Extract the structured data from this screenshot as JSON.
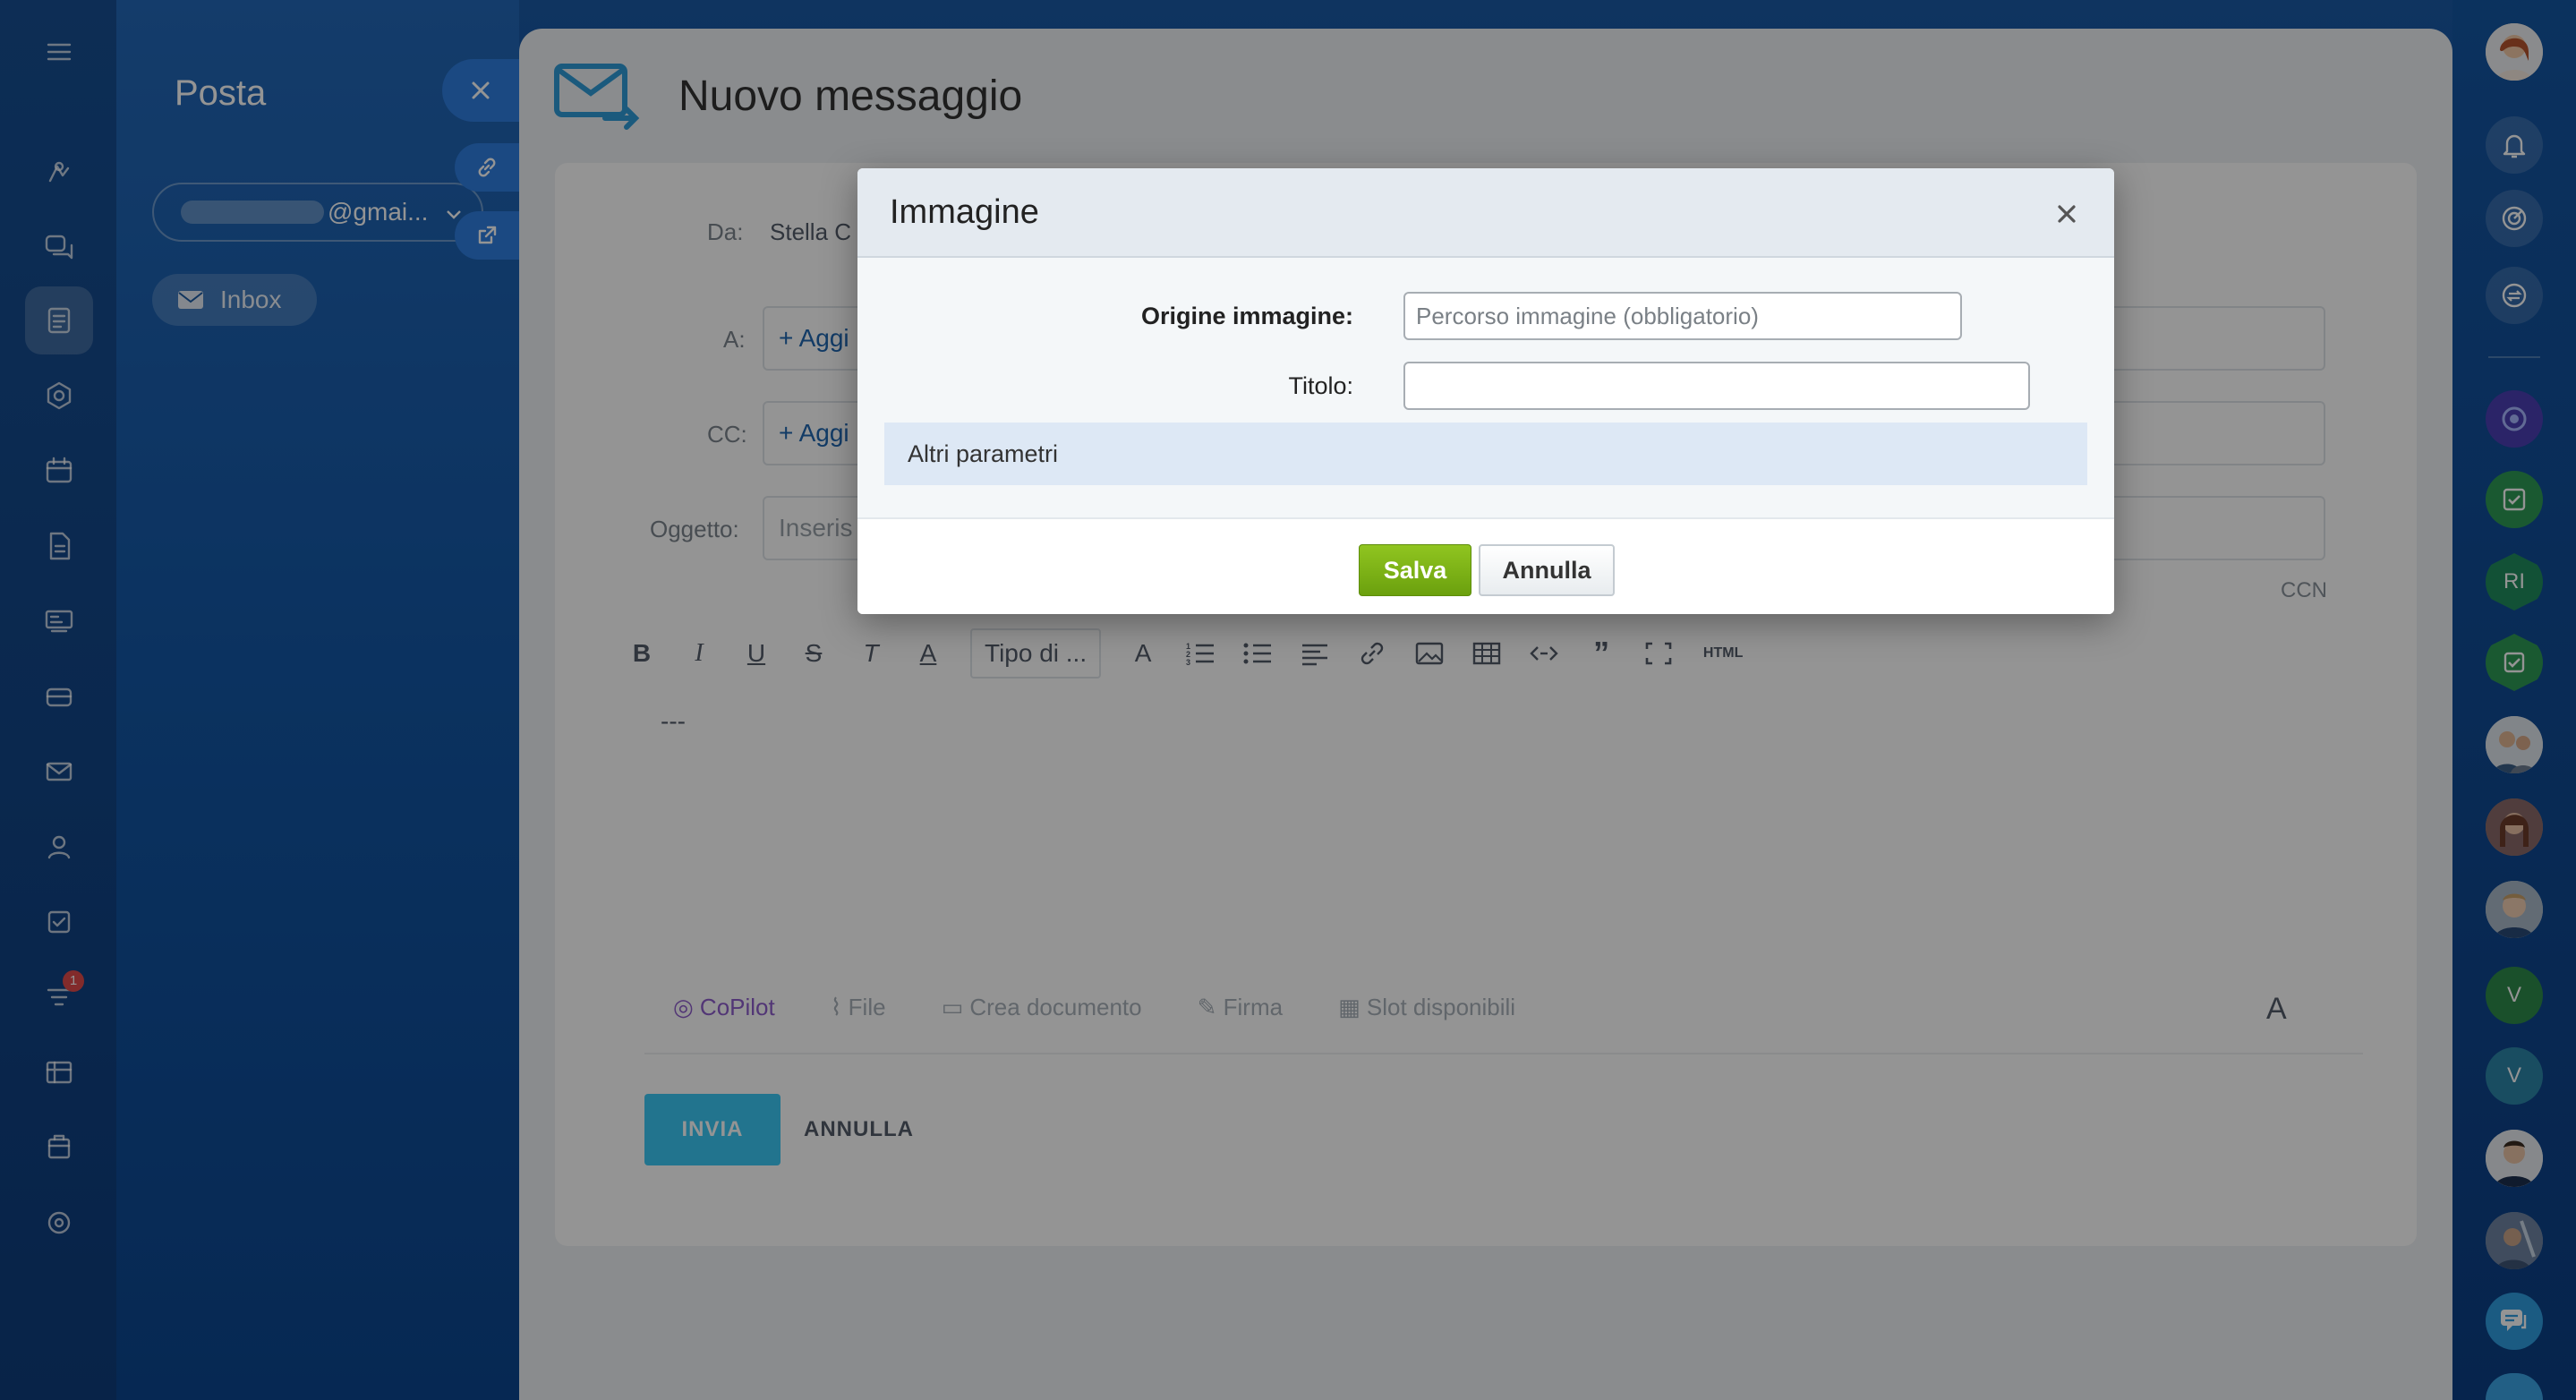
{
  "colors": {
    "accent": "#2f7ee0",
    "save_green": "#7cb518",
    "send_blue": "#3bc8f5",
    "dialog_header": "#e4eaf0",
    "more_params_bg": "#dde8f5"
  },
  "left_rail": {
    "icons": [
      "menu-icon",
      "feed-icon",
      "chat-icon",
      "mail-doc-icon",
      "shield-icon",
      "calendar-icon",
      "document-icon",
      "board-icon",
      "store-icon",
      "envelope-icon",
      "contacts-icon",
      "tasks-icon",
      "filter-icon",
      "sheet-icon",
      "inventory-icon",
      "target-icon"
    ],
    "badge": "1"
  },
  "mail_panel": {
    "title": "Posta",
    "account": "@gmai...",
    "inbox": "Inbox"
  },
  "slider": {
    "title": "Nuovo messaggio",
    "from_label": "Da:",
    "from_value": "Stella C",
    "to_label": "A:",
    "to_value": "+ Aggi",
    "cc_label": "CC:",
    "cc_value": "+ Aggi",
    "subject_label": "Oggetto:",
    "subject_value": "Inseris",
    "ccn_label": "CCN",
    "toolbar": {
      "style_select": "Tipo di ...",
      "html_label": "HTML"
    },
    "editor_signature": "---",
    "bottom_tools": {
      "copilot": "CoPilot",
      "file": "File",
      "create_doc": "Crea documento",
      "sign": "Firma",
      "slots": "Slot disponibili",
      "font": "A"
    },
    "send": "INVIA",
    "cancel": "ANNULLA"
  },
  "right_rail": {
    "initials_ri": "RI",
    "initials_v1": "V",
    "initials_v2": "V"
  },
  "dialog": {
    "title": "Immagine",
    "source_label": "Origine immagine:",
    "source_placeholder": "Percorso immagine (obbligatorio)",
    "title_label": "Titolo:",
    "title_value": "",
    "more_params": "Altri parametri",
    "save": "Salva",
    "cancel": "Annulla"
  }
}
